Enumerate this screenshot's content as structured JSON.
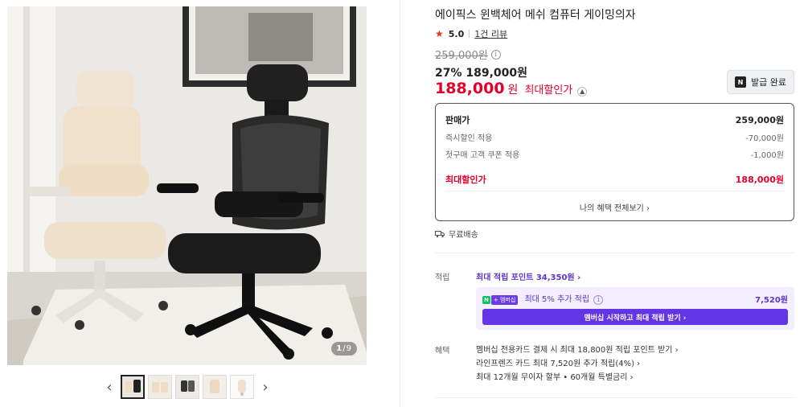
{
  "gallery": {
    "counter_current": "1",
    "counter_total": "/9",
    "prev_arrow": "‹",
    "next_arrow": "›",
    "thumbnail_count": 5
  },
  "product": {
    "title": "에이픽스 윈백체어 메쉬 컴퓨터 게이밍의자",
    "rating": "5.0",
    "review_link": "1건 리뷰",
    "original_price": "259,000원",
    "sale_line": "27% 189,000원",
    "max_price": "188,000",
    "max_price_unit": "원",
    "max_label": "최대할인가",
    "coupon_button": "발급 완료"
  },
  "price_box": {
    "rows": [
      {
        "label": "판매가",
        "value": "259,000원"
      },
      {
        "label": "즉시할인 적용",
        "value": "-70,000원"
      },
      {
        "label": "첫구매 고객 쿠폰 적용",
        "value": "-1,000원"
      },
      {
        "label": "최대할인가",
        "value": "188,000원"
      }
    ],
    "more_link": "나의 혜택 전체보기 ›"
  },
  "delivery": {
    "label": "무료배송"
  },
  "points": {
    "section_label": "적립",
    "max_points_link": "최대 적립 포인트 34,350원 ›",
    "member_tag_n": "N",
    "member_tag_plus": "+ 멤버십",
    "member_text": "최대 5% 추가 적립",
    "member_amount": "7,520원",
    "member_button": "멤버십 시작하고 최대 적립 받기 ›"
  },
  "benefits": {
    "section_label": "혜택",
    "items": [
      "멤버십 전용카드 결제 시 최대 18,800원 적립 포인트 받기 ›",
      "라인프렌즈 카드 최대 7,520원 추가 적립(4%) ›",
      "최대 12개월 무이자 할부 • 60개월 특별금리 ›"
    ]
  },
  "colors": {
    "accent_red": "#e4002b",
    "membership_purple": "#6336e5",
    "naver_green": "#03c75a"
  }
}
